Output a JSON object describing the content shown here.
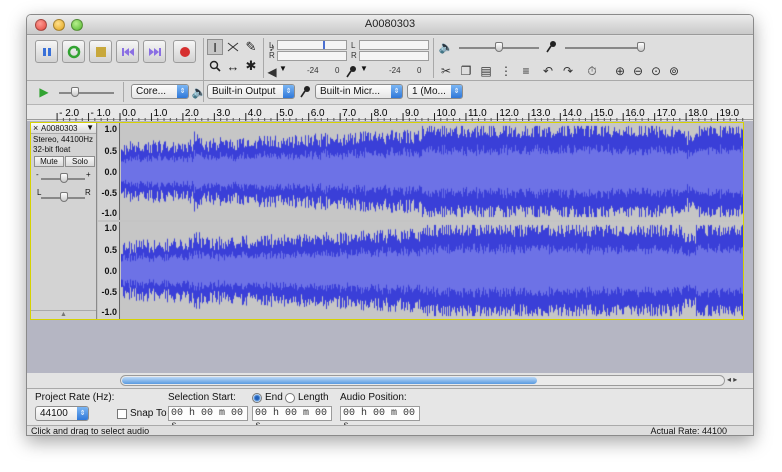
{
  "window": {
    "title": "A0080303"
  },
  "transport": {
    "buttons": [
      "pause-icon",
      "play-icon",
      "stop-icon",
      "skip-start-icon",
      "skip-end-icon",
      "record-icon"
    ]
  },
  "meters": {
    "play_l": "L",
    "play_r": "R",
    "rec_l": "L",
    "rec_r": "R",
    "scale_a": "-24",
    "scale_b": "0",
    "scale_c": "-24",
    "scale_d": "0"
  },
  "devices": {
    "host": "Core...",
    "output": "Built-in Output",
    "input": "Built-in Micr...",
    "channels": "1 (Mo..."
  },
  "ruler": {
    "labels": [
      "- 2.0",
      "- 1.0",
      "0.0",
      "1.0",
      "2.0",
      "3.0",
      "4.0",
      "5.0",
      "6.0",
      "7.0",
      "8.0",
      "9.0",
      "10.0",
      "11.0",
      "12.0",
      "13.0",
      "14.0",
      "15.0",
      "16.0",
      "17.0",
      "18.0",
      "19.0"
    ]
  },
  "track": {
    "name": "A0080303",
    "info1": "Stereo, 44100Hz",
    "info2": "32-bit float",
    "mute": "Mute",
    "solo": "Solo",
    "gain_minus": "-",
    "gain_plus": "+",
    "pan_l": "L",
    "pan_r": "R",
    "scale": [
      "1.0",
      "0.5",
      "0.0",
      "-0.5",
      "-1.0"
    ]
  },
  "selection": {
    "project_rate_label": "Project Rate (Hz):",
    "project_rate": "44100",
    "snap_to": "Snap To",
    "selection_start_label": "Selection Start:",
    "end_label": "End",
    "length_label": "Length",
    "audio_position_label": "Audio Position:",
    "start_value": "00 h 00 m 00 s",
    "end_value": "00 h 00 m 00 s",
    "position_value": "00 h 00 m 00 s"
  },
  "status": {
    "left": "Click and drag to select audio",
    "right": "Actual Rate: 44100"
  },
  "colors": {
    "waveform": "#3a3fd8",
    "waveform_rms": "#6d72e6",
    "track_border": "#d6d200"
  }
}
